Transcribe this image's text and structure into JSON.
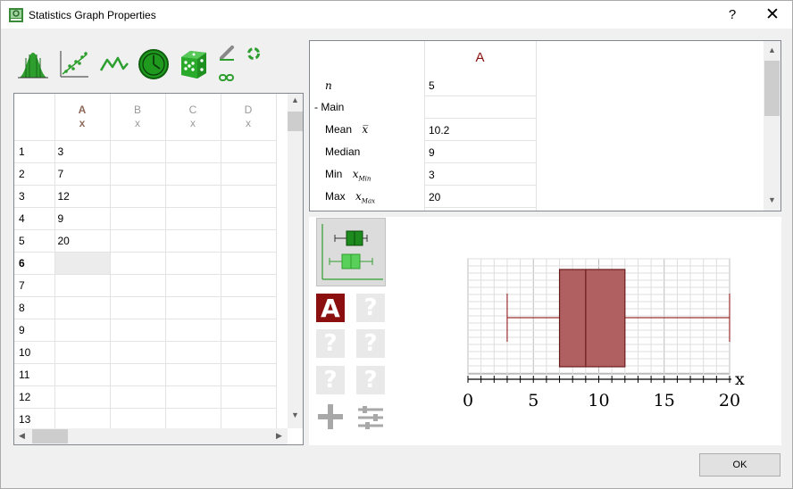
{
  "window": {
    "title": "Statistics Graph Properties",
    "help_label": "?",
    "close_label": "✕"
  },
  "spreadsheet": {
    "columns": [
      {
        "letter": "A",
        "sub": "x"
      },
      {
        "letter": "B",
        "sub": "x"
      },
      {
        "letter": "C",
        "sub": "x"
      },
      {
        "letter": "D",
        "sub": "x"
      }
    ],
    "rows": [
      {
        "num": "1",
        "a": "3"
      },
      {
        "num": "2",
        "a": "7"
      },
      {
        "num": "3",
        "a": "12"
      },
      {
        "num": "4",
        "a": "9"
      },
      {
        "num": "5",
        "a": "20"
      },
      {
        "num": "6",
        "a": ""
      },
      {
        "num": "7",
        "a": ""
      },
      {
        "num": "8",
        "a": ""
      },
      {
        "num": "9",
        "a": ""
      },
      {
        "num": "10",
        "a": ""
      },
      {
        "num": "11",
        "a": ""
      },
      {
        "num": "12",
        "a": ""
      },
      {
        "num": "13",
        "a": ""
      }
    ],
    "selected_row": "6"
  },
  "stats": {
    "column_header": "A",
    "n_label": "n",
    "n_value": "5",
    "main_label": "- Main",
    "mean_label": "Mean",
    "mean_symbol": "x̅",
    "mean_value": "10.2",
    "median_label": "Median",
    "median_value": "9",
    "min_label": "Min",
    "min_symbol": "x",
    "min_sub": "Min",
    "min_value": "3",
    "max_label": "Max",
    "max_symbol": "x",
    "max_sub": "Max",
    "max_value": "20"
  },
  "tools": {
    "dataset_label": "A",
    "question_label": "?"
  },
  "chart_data": {
    "type": "box",
    "series": [
      {
        "name": "A",
        "min": 3,
        "q1": 7,
        "median": 9,
        "q3": 12,
        "max": 20
      }
    ],
    "xlabel": "x",
    "xlim": [
      0,
      20
    ],
    "xticks": [
      "0",
      "5",
      "10",
      "15",
      "20"
    ],
    "grid": true,
    "color": "#b06060"
  },
  "buttons": {
    "ok_label": "OK"
  }
}
